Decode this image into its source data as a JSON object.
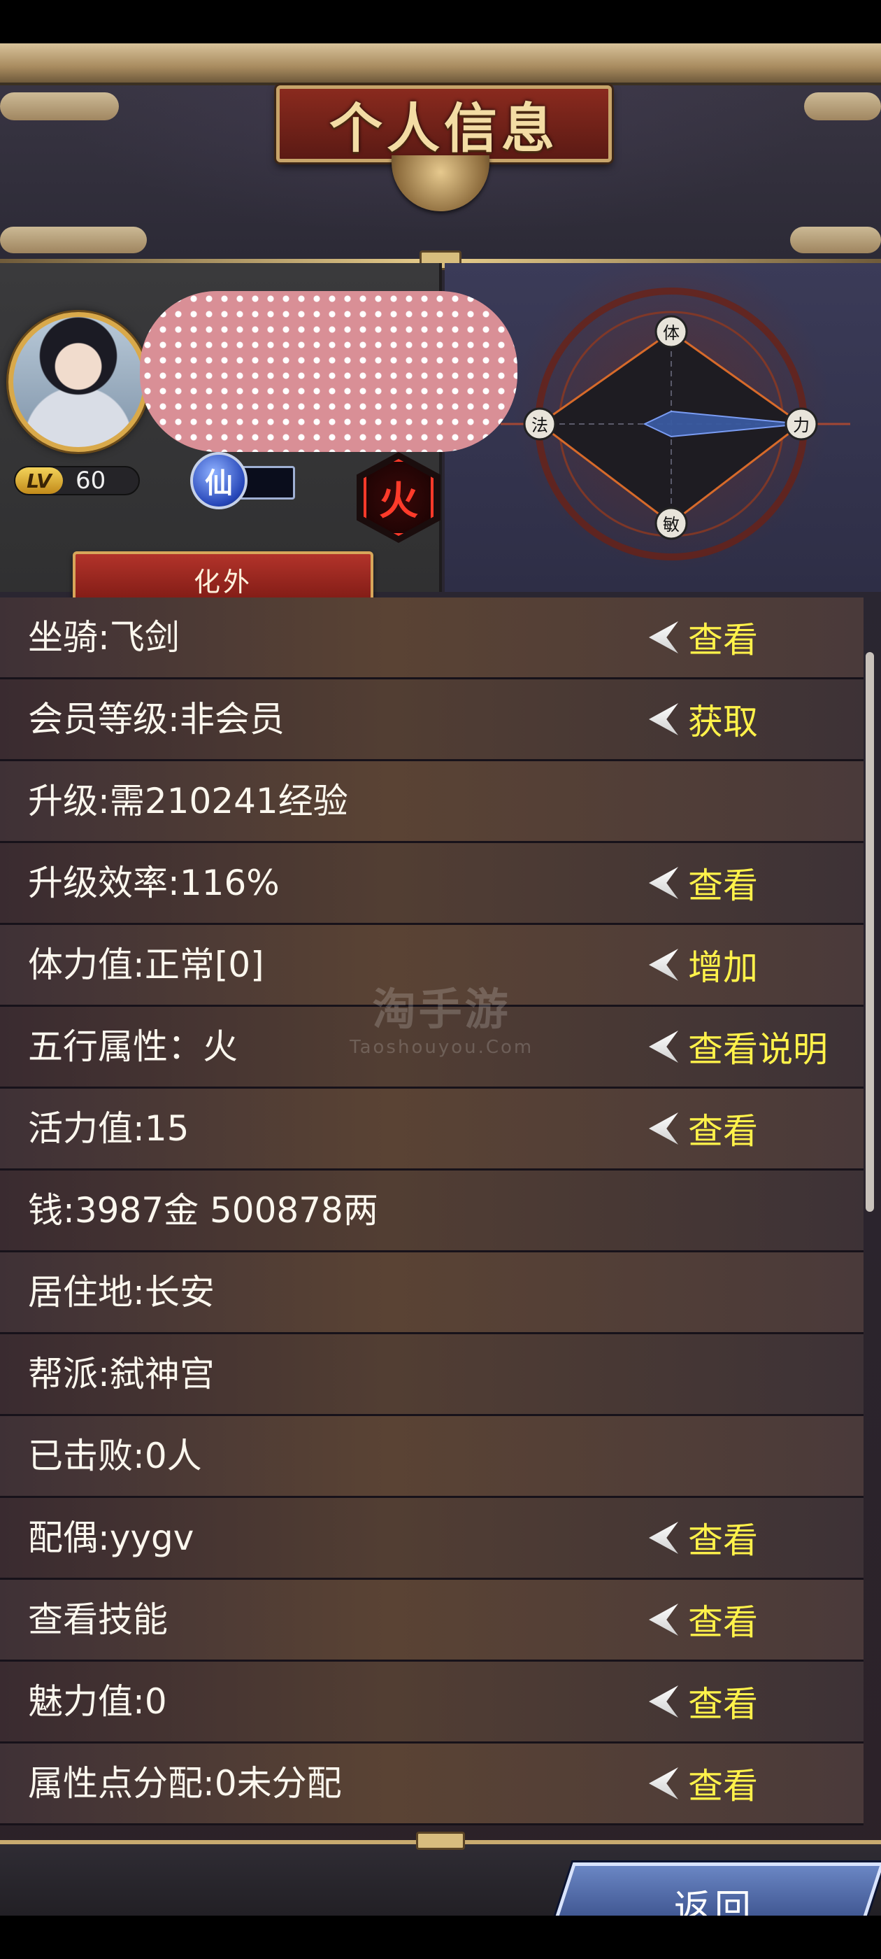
{
  "header": {
    "title": "个人信息"
  },
  "profile": {
    "level_tag": "LV",
    "level": "60",
    "xian_icon": "仙",
    "element_icon": "火",
    "realm_button": "化外"
  },
  "radar": {
    "labels": {
      "top": "体",
      "left": "法",
      "right": "力",
      "bottom": "敏"
    }
  },
  "rows": [
    {
      "label": "坐骑:飞剑",
      "action": "查看"
    },
    {
      "label": "会员等级:非会员",
      "action": "获取"
    },
    {
      "label": "升级:需210241经验",
      "action": ""
    },
    {
      "label": "升级效率:116%",
      "action": "查看"
    },
    {
      "label": "体力值:正常[0]",
      "action": "增加"
    },
    {
      "label": "五行属性：火",
      "action": "查看说明"
    },
    {
      "label": "活力值:15",
      "action": "查看"
    },
    {
      "label": "钱:3987金 500878两",
      "action": ""
    },
    {
      "label": "居住地:长安",
      "action": ""
    },
    {
      "label": "帮派:弑神宫",
      "action": ""
    },
    {
      "label": "已击败:0人",
      "action": ""
    },
    {
      "label": "配偶:yygv",
      "action": "查看"
    },
    {
      "label": "查看技能",
      "action": "查看"
    },
    {
      "label": "魅力值:0",
      "action": "查看"
    },
    {
      "label": "属性点分配:0未分配",
      "action": "查看"
    }
  ],
  "watermark": {
    "main": "淘手游",
    "sub": "Taoshouyou.Com"
  },
  "footer": {
    "back_label": "返回"
  }
}
